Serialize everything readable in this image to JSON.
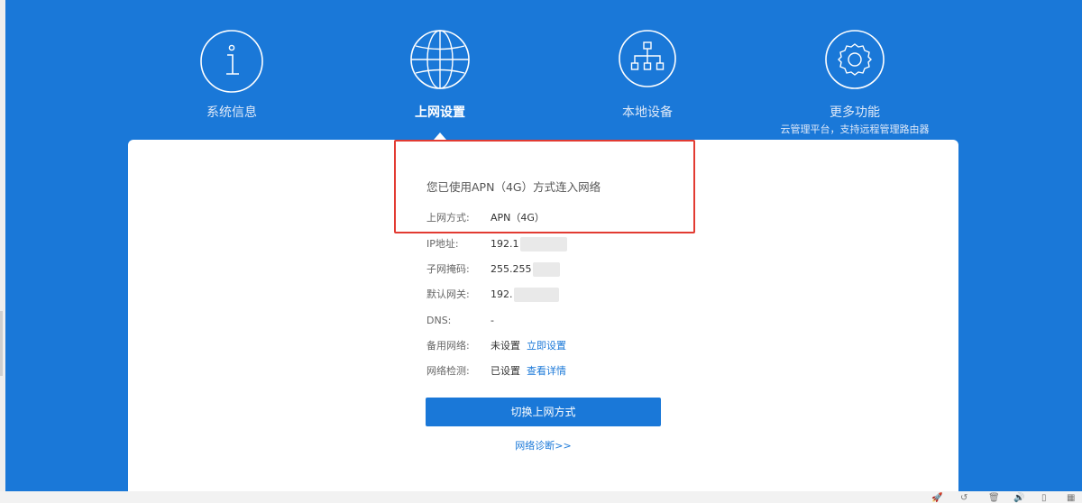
{
  "nav": {
    "items": [
      {
        "label": "系统信息",
        "icon": "info-icon"
      },
      {
        "label": "上网设置",
        "icon": "globe-icon",
        "active": true
      },
      {
        "label": "本地设备",
        "icon": "network-tree-icon"
      },
      {
        "label": "更多功能",
        "icon": "gear-icon",
        "sub": "云管理平台，支持远程管理路由器"
      }
    ]
  },
  "status": {
    "title": "您已使用APN（4G）方式连入网络",
    "rows": [
      {
        "key": "上网方式:",
        "value": "APN（4G）"
      },
      {
        "key": "IP地址:",
        "value": "192.1"
      },
      {
        "key": "子网掩码:",
        "value": "255.255"
      },
      {
        "key": "默认网关:",
        "value": "192."
      },
      {
        "key": "DNS:",
        "value": "-"
      },
      {
        "key": "备用网络:",
        "value": "未设置",
        "link": "立即设置"
      },
      {
        "key": "网络检测:",
        "value": "已设置",
        "link": "查看详情"
      }
    ]
  },
  "actions": {
    "switch_label": "切换上网方式",
    "diagnose_label": "网络诊断>>"
  },
  "colors": {
    "brand": "#1a78d8",
    "highlight": "#e23b32"
  }
}
